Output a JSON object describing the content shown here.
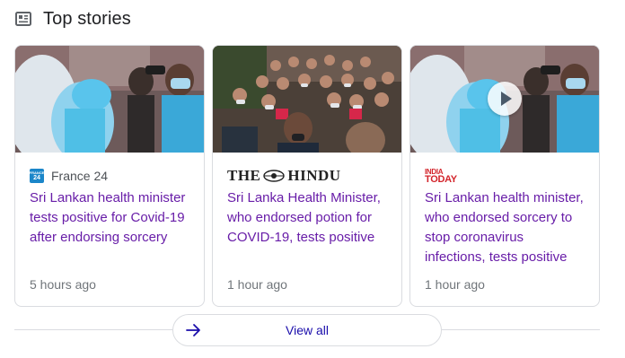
{
  "section": {
    "title": "Top stories",
    "header_icon": "newspaper-icon"
  },
  "cards": [
    {
      "source": "France 24",
      "source_logo_text": "FRANCE 24",
      "headline": "Sri Lankan health minister tests positive for Covid-19 after endorsing sorcery",
      "time": "5 hours ago",
      "has_video": false
    },
    {
      "source": "THE HINDU",
      "masthead_left": "THE",
      "masthead_right": "HINDU",
      "headline": "Sri Lanka Health Minister, who endorsed potion for COVID-19, tests positive",
      "time": "1 hour ago",
      "has_video": false
    },
    {
      "source": "INDIA TODAY",
      "logo_top": "INDIA",
      "logo_bottom": "TODAY",
      "headline": "Sri Lankan health minister, who endorsed sorcery to stop coronavirus infections, tests positive",
      "time": "1 hour ago",
      "has_video": true
    }
  ],
  "view_all": {
    "label": "View all",
    "icon": "arrow-right-icon"
  },
  "colors": {
    "headline_visited": "#681da8",
    "link": "#1a0dab",
    "meta": "#70757a",
    "border": "#dadce0",
    "india_today_red": "#d3242b"
  }
}
